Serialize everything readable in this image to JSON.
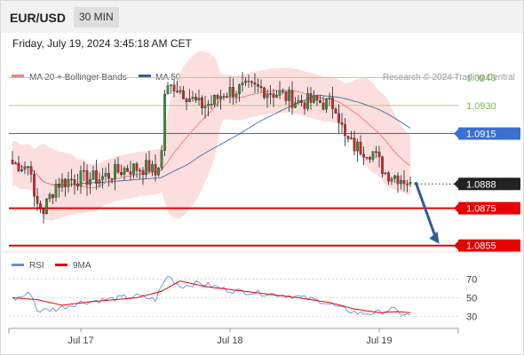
{
  "header": {
    "pair": "EUR/USD",
    "timeframe": "30 MIN"
  },
  "datetime": "Friday, July 19, 2024 3:45:18 AM CET",
  "legend": {
    "ma20": "MA 20 + Bollinger Bands",
    "ma50": "MA 50",
    "credit": "Research © 2024 Trading Central",
    "rsi": "RSI",
    "ma9": "9MA"
  },
  "colors": {
    "ma20": "#f08080",
    "ma50": "#2f5d95",
    "band": "#fcd3d3",
    "green_level": "#78b84a",
    "pivot": "#3b6fd1",
    "support": "#e60000",
    "current": "#222222",
    "arrow": "#2f5d95",
    "rsi": "#6b8fd6",
    "rsi_ma": "#e60000"
  },
  "chart_data": [
    {
      "type": "candlestick",
      "name": "price",
      "ylim": [
        1.0852,
        1.0958
      ],
      "x_ticks": [
        {
          "label": "Jul 17",
          "index": 22
        },
        {
          "label": "Jul 18",
          "index": 70
        },
        {
          "label": "Jul 19",
          "index": 118
        }
      ],
      "candle_count": 129,
      "levels": [
        {
          "label": "1.0945",
          "value": 1.0945,
          "kind": "resistance"
        },
        {
          "label": "1.0930",
          "value": 1.093,
          "kind": "resistance"
        },
        {
          "label": "1.0915",
          "value": 1.0915,
          "kind": "pivot"
        },
        {
          "label": "1.0888",
          "value": 1.0888,
          "kind": "current"
        },
        {
          "label": "1.0875",
          "value": 1.0875,
          "kind": "support"
        },
        {
          "label": "1.0855",
          "value": 1.0855,
          "kind": "support"
        }
      ],
      "anchors": [
        [
          0,
          1.0899
        ],
        [
          6,
          1.0897
        ],
        [
          7,
          1.0878
        ],
        [
          10,
          1.0874
        ],
        [
          14,
          1.0888
        ],
        [
          20,
          1.0891
        ],
        [
          28,
          1.0891
        ],
        [
          36,
          1.0896
        ],
        [
          44,
          1.0897
        ],
        [
          46,
          1.0893
        ],
        [
          48,
          1.0905
        ],
        [
          49,
          1.0937
        ],
        [
          52,
          1.0941
        ],
        [
          56,
          1.0936
        ],
        [
          60,
          1.093
        ],
        [
          64,
          1.0931
        ],
        [
          68,
          1.0937
        ],
        [
          74,
          1.0939
        ],
        [
          80,
          1.0939
        ],
        [
          86,
          1.0936
        ],
        [
          92,
          1.0932
        ],
        [
          98,
          1.0932
        ],
        [
          104,
          1.093
        ],
        [
          107,
          1.0912
        ],
        [
          110,
          1.0908
        ],
        [
          116,
          1.0905
        ],
        [
          120,
          1.0894
        ],
        [
          124,
          1.0892
        ],
        [
          128,
          1.0889
        ]
      ],
      "projection": {
        "from": [
          128,
          1.0888
        ],
        "to": [
          137,
          1.0855
        ]
      }
    },
    {
      "type": "line",
      "name": "RSI",
      "ylim": [
        20,
        80
      ],
      "y_ticks": [
        70,
        50,
        30
      ],
      "series": [
        {
          "name": "RSI",
          "anchors": [
            [
              0,
              48
            ],
            [
              6,
              55
            ],
            [
              8,
              36
            ],
            [
              14,
              38
            ],
            [
              22,
              45
            ],
            [
              30,
              48
            ],
            [
              40,
              52
            ],
            [
              46,
              48
            ],
            [
              48,
              62
            ],
            [
              50,
              74
            ],
            [
              54,
              62
            ],
            [
              60,
              66
            ],
            [
              70,
              58
            ],
            [
              80,
              55
            ],
            [
              90,
              52
            ],
            [
              100,
              46
            ],
            [
              106,
              38
            ],
            [
              112,
              33
            ],
            [
              118,
              34
            ],
            [
              122,
              38
            ],
            [
              125,
              33
            ],
            [
              128,
              31
            ]
          ]
        },
        {
          "name": "9MA",
          "anchors": [
            [
              0,
              50
            ],
            [
              8,
              48
            ],
            [
              16,
              42
            ],
            [
              26,
              46
            ],
            [
              40,
              50
            ],
            [
              48,
              57
            ],
            [
              54,
              68
            ],
            [
              62,
              62
            ],
            [
              72,
              58
            ],
            [
              82,
              54
            ],
            [
              92,
              50
            ],
            [
              102,
              45
            ],
            [
              110,
              38
            ],
            [
              118,
              34
            ],
            [
              124,
              35
            ],
            [
              128,
              34
            ]
          ]
        }
      ]
    }
  ]
}
